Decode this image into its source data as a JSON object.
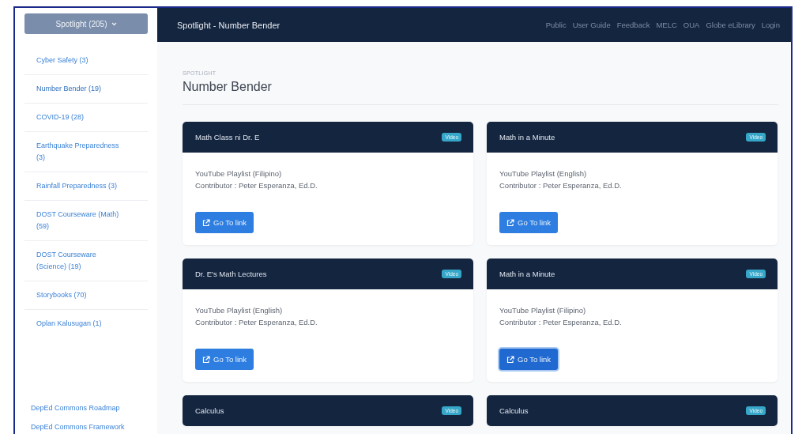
{
  "sidebar": {
    "dropdown": {
      "label": "Spotlight (205)"
    },
    "items": [
      {
        "label": "Cyber Safety (3)",
        "selected": false
      },
      {
        "label": "Number Bender (19)",
        "selected": true
      },
      {
        "label": "COVID-19 (28)",
        "selected": false
      },
      {
        "label": "Earthquake Preparedness (3)",
        "selected": false
      },
      {
        "label": "Rainfall Preparedness (3)",
        "selected": false
      },
      {
        "label": "DOST Courseware (Math) (59)",
        "selected": false
      },
      {
        "label": "DOST Courseware (Science) (19)",
        "selected": false
      },
      {
        "label": "Storybooks (70)",
        "selected": false
      },
      {
        "label": "Oplan Kalusugan (1)",
        "selected": false
      }
    ],
    "footer_links": [
      "DepEd Commons Roadmap",
      "DepEd Commons Framework"
    ]
  },
  "header": {
    "title": "Spotlight - Number Bender",
    "nav": [
      "Public",
      "User Guide",
      "Feedback",
      "MELC",
      "OUA",
      "Globe eLibrary",
      "Login"
    ]
  },
  "page": {
    "eyebrow": "SPOTLIGHT",
    "title": "Number Bender"
  },
  "cards": [
    {
      "title": "Math Class ni Dr. E",
      "badge": "Video",
      "description": "YouTube Playlist (Filipino)",
      "contributor": "Contributor : Peter Esperanza, Ed.D.",
      "button": {
        "label": "Go To link",
        "focused": false
      }
    },
    {
      "title": "Math in a Minute",
      "badge": "Video",
      "description": "YouTube Playlist (English)",
      "contributor": "Contributor : Peter Esperanza, Ed.D.",
      "button": {
        "label": "Go To link",
        "focused": false
      }
    },
    {
      "title": "Dr. E's Math Lectures",
      "badge": "Video",
      "description": "YouTube Playlist (English)",
      "contributor": "Contributor : Peter Esperanza, Ed.D.",
      "button": {
        "label": "Go To link",
        "focused": false
      }
    },
    {
      "title": "Math in a Minute",
      "badge": "Video",
      "description": "YouTube Playlist (Filipino)",
      "contributor": "Contributor : Peter Esperanza, Ed.D.",
      "button": {
        "label": "Go To link",
        "focused": true
      }
    },
    {
      "title": "Calculus",
      "badge": "Video"
    },
    {
      "title": "Calculus",
      "badge": "Video"
    }
  ]
}
